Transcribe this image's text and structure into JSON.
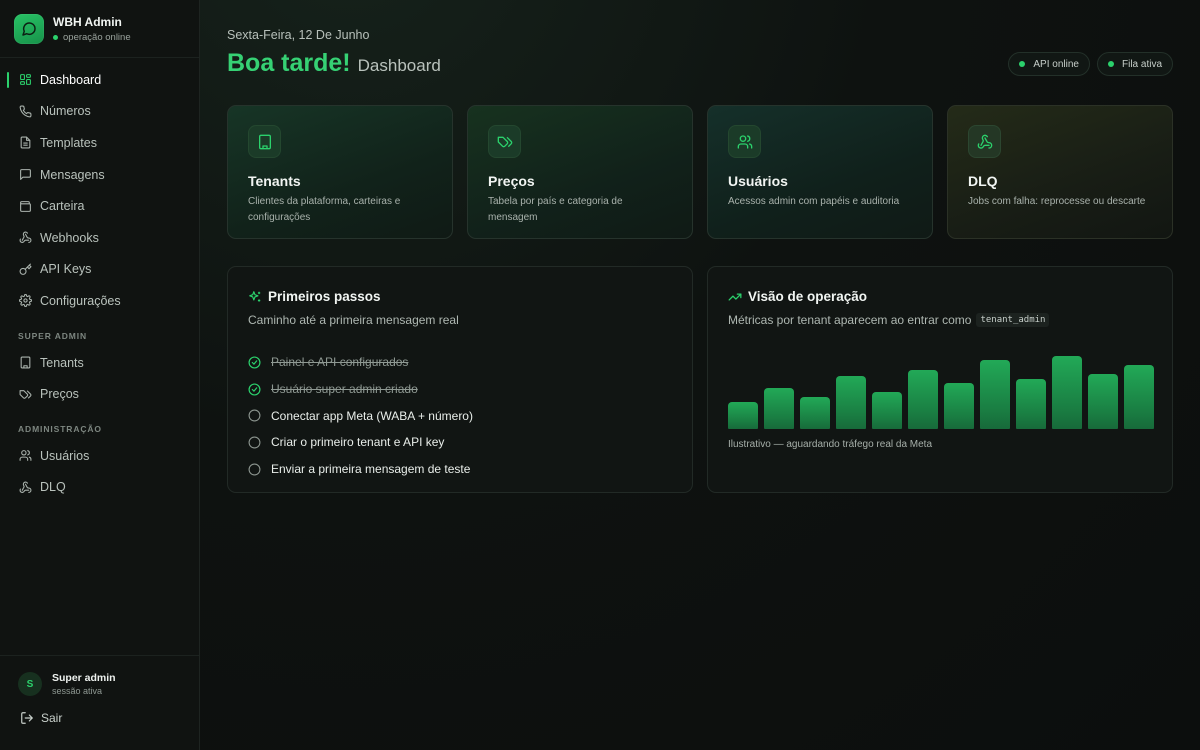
{
  "brand": {
    "title": "WBH Admin",
    "status": "operação online"
  },
  "nav": {
    "main": [
      {
        "label": "Dashboard",
        "icon": "dashboard-icon",
        "active": true
      },
      {
        "label": "Números",
        "icon": "phone-icon"
      },
      {
        "label": "Templates",
        "icon": "document-icon"
      },
      {
        "label": "Mensagens",
        "icon": "message-icon"
      },
      {
        "label": "Carteira",
        "icon": "wallet-icon"
      },
      {
        "label": "Webhooks",
        "icon": "webhook-icon"
      },
      {
        "label": "API Keys",
        "icon": "key-icon"
      },
      {
        "label": "Configurações",
        "icon": "gear-icon"
      }
    ],
    "super_admin_title": "SUPER ADMIN",
    "super_admin": [
      {
        "label": "Tenants",
        "icon": "building-icon"
      },
      {
        "label": "Preços",
        "icon": "price-tag-icon"
      }
    ],
    "administracao_title": "ADMINISTRAÇÃO",
    "administracao": [
      {
        "label": "Usuários",
        "icon": "users-icon"
      },
      {
        "label": "DLQ",
        "icon": "webhook-icon"
      }
    ]
  },
  "user": {
    "initial": "S",
    "name": "Super admin",
    "session": "sessão ativa"
  },
  "logout_label": "Sair",
  "header": {
    "date": "Sexta-Feira, 12 De Junho",
    "greeting": "Boa tarde!",
    "subtitle": "Dashboard",
    "pills": [
      "API online",
      "Fila ativa"
    ]
  },
  "cards": [
    {
      "title": "Tenants",
      "desc": "Clientes da plataforma, carteiras e configurações",
      "icon": "building-icon"
    },
    {
      "title": "Preços",
      "desc": "Tabela por país e categoria de mensagem",
      "icon": "price-tag-icon"
    },
    {
      "title": "Usuários",
      "desc": "Acessos admin com papéis e auditoria",
      "icon": "users-icon"
    },
    {
      "title": "DLQ",
      "desc": "Jobs com falha: reprocesse ou descarte",
      "icon": "webhook-icon"
    }
  ],
  "first_steps": {
    "title": "Primeiros passos",
    "subtitle": "Caminho até a primeira mensagem real",
    "steps": [
      {
        "label": "Painel e API configurados",
        "done": true
      },
      {
        "label": "Usuário super admin criado",
        "done": true
      },
      {
        "label": "Conectar app Meta (WABA + número)",
        "done": false
      },
      {
        "label": "Criar o primeiro tenant e API key",
        "done": false
      },
      {
        "label": "Enviar a primeira mensagem de teste",
        "done": false
      }
    ]
  },
  "operation": {
    "title": "Visão de operação",
    "subtitle": "Métricas por tenant aparecem ao entrar como",
    "code": "tenant_admin",
    "note": "Ilustrativo — aguardando tráfego real da Meta",
    "bar_levels": [
      0.36,
      0.55,
      0.43,
      0.72,
      0.5,
      0.8,
      0.62,
      0.93,
      0.67,
      0.98,
      0.75,
      0.86
    ]
  },
  "colors": {
    "accent": "#2bd16c",
    "greeting": "#36d174",
    "bar": "#1f9e52"
  }
}
